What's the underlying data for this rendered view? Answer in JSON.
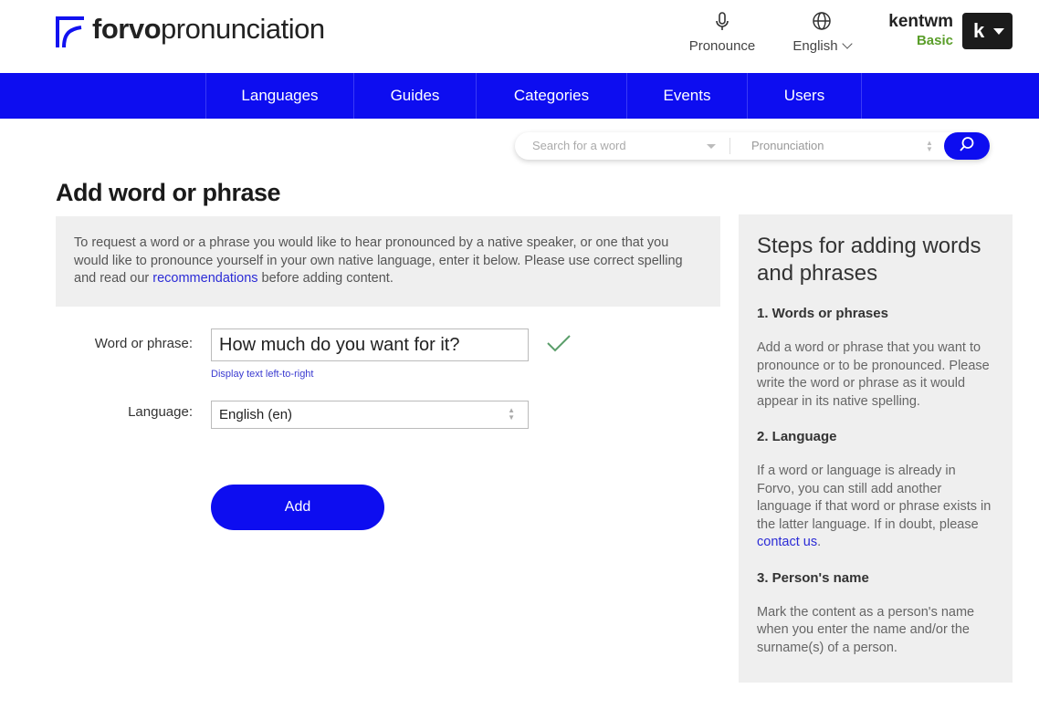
{
  "header": {
    "logo_bold": "forvo",
    "logo_rest": "pronunciation",
    "pronounce_label": "Pronounce",
    "language_label": "English",
    "username": "kentwm",
    "plan": "Basic",
    "avatar_letter": "k"
  },
  "nav": {
    "items": [
      {
        "label": "Languages"
      },
      {
        "label": "Guides"
      },
      {
        "label": "Categories"
      },
      {
        "label": "Events"
      },
      {
        "label": "Users"
      }
    ]
  },
  "search": {
    "placeholder": "Search for a word",
    "type_value": "Pronunciation"
  },
  "main": {
    "title": "Add word or phrase",
    "intro_before": "To request a word or a phrase you would like to hear pronounced by a native speaker, or one that you would like to pronounce yourself in your own native language, enter it below. Please use correct spelling and read our ",
    "intro_link": "recommendations",
    "intro_after": " before adding content.",
    "word_label": "Word or phrase:",
    "word_value": "How much do you want for it?",
    "ltr_link": "Display text left-to-right",
    "language_label": "Language:",
    "language_value": "English (en)",
    "add_button": "Add"
  },
  "sidebar": {
    "title": "Steps for adding words and phrases",
    "step1_title": "1. Words or phrases",
    "step1_text": "Add a word or phrase that you want to pronounce or to be pronounced. Please write the word or phrase as it would appear in its native spelling.",
    "step2_title": "2. Language",
    "step2_text": "If a word or language is already in Forvo, you can still add another language if that word or phrase exists in the latter language. If in doubt, please ",
    "step2_link": "contact us",
    "step2_after": ".",
    "step3_title": "3. Person's name",
    "step3_text": "Mark the content as a person's name when you enter the name and/or the surname(s) of a person."
  },
  "colors": {
    "brand_blue": "#0d0df0",
    "plan_green": "#5a9e2a",
    "check_green": "#5a9e6a"
  }
}
